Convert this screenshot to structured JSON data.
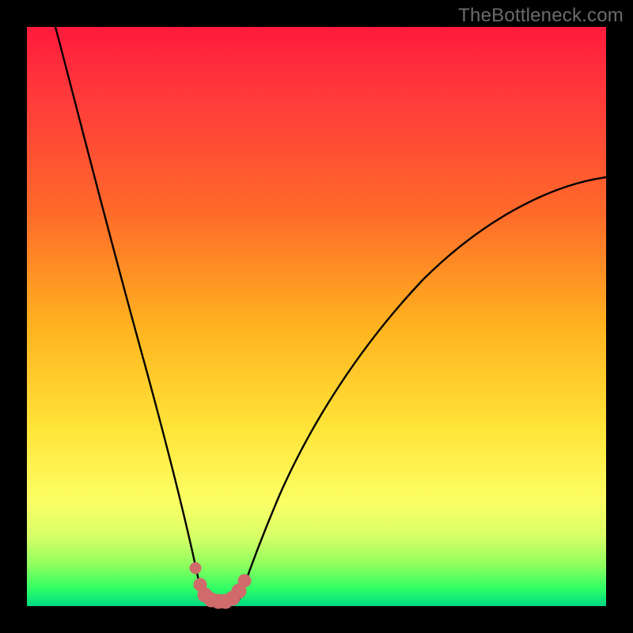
{
  "watermark": "TheBottleneck.com",
  "chart_data": {
    "type": "line",
    "title": "",
    "xlabel": "",
    "ylabel": "",
    "xlim": [
      0,
      100
    ],
    "ylim": [
      0,
      100
    ],
    "series": [
      {
        "name": "left-branch",
        "x": [
          5,
          10,
          15,
          20,
          23,
          26,
          28,
          29.5
        ],
        "values": [
          100,
          82,
          62,
          40,
          25,
          12,
          5,
          1
        ]
      },
      {
        "name": "right-branch",
        "x": [
          35.5,
          38,
          42,
          50,
          60,
          72,
          86,
          100
        ],
        "values": [
          1,
          5,
          13,
          28,
          42,
          55,
          66,
          74
        ]
      },
      {
        "name": "trough-markers",
        "x": [
          28,
          29,
          30,
          31,
          32,
          33,
          34,
          35,
          36
        ],
        "values": [
          6,
          2.5,
          1,
          0.5,
          0.5,
          0.5,
          1,
          2,
          4
        ]
      }
    ],
    "marker_color": "#cf6b6b",
    "curve_color": "#000000",
    "gradient_stops": [
      {
        "pos": 0,
        "color": "#ff1a3d"
      },
      {
        "pos": 50,
        "color": "#ffe63a"
      },
      {
        "pos": 100,
        "color": "#00d982"
      }
    ]
  }
}
